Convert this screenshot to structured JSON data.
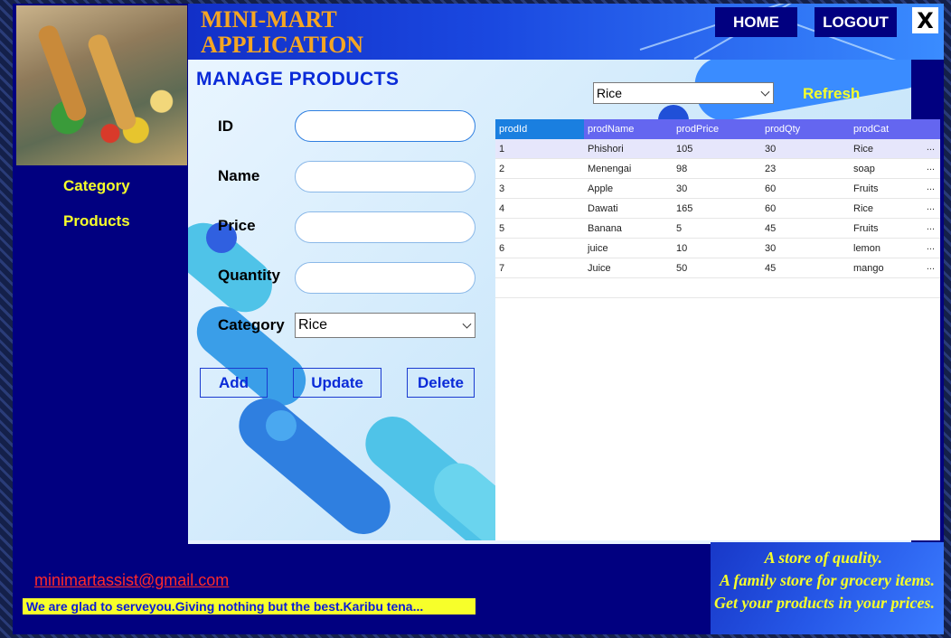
{
  "app": {
    "title_line1": "MINI-MART",
    "title_line2": "APPLICATION",
    "home_label": "HOME",
    "logout_label": "LOGOUT",
    "close_label": "X"
  },
  "sidebar": {
    "items": [
      {
        "label": "Category"
      },
      {
        "label": "Products"
      }
    ]
  },
  "page": {
    "title": "MANAGE PRODUCTS"
  },
  "form": {
    "id_label": "ID",
    "id_value": "",
    "name_label": "Name",
    "name_value": "",
    "price_label": "Price",
    "price_value": "",
    "quantity_label": "Quantity",
    "quantity_value": "",
    "category_label": "Category",
    "category_value": "Rice",
    "add_label": "Add",
    "update_label": "Update",
    "delete_label": "Delete"
  },
  "filter": {
    "category_value": "Rice",
    "refresh_label": "Refresh"
  },
  "grid": {
    "columns": [
      "prodId",
      "prodName",
      "prodPrice",
      "prodQty",
      "prodCat"
    ],
    "rows": [
      [
        "1",
        "Phishori",
        "105",
        "30",
        "Rice"
      ],
      [
        "2",
        "Menengai",
        "98",
        "23",
        "soap"
      ],
      [
        "3",
        "Apple",
        "30",
        "60",
        "Fruits"
      ],
      [
        "4",
        "Dawati",
        "165",
        "60",
        "Rice"
      ],
      [
        "5",
        "Banana",
        "5",
        "45",
        "Fruits"
      ],
      [
        "6",
        "juice",
        "10",
        "30",
        "lemon"
      ],
      [
        "7",
        "Juice",
        "50",
        "45",
        "mango"
      ]
    ],
    "overflow_marker": "..."
  },
  "footer": {
    "email": "minimartassist@gmail.com",
    "marquee": "We are glad to serveyou.Giving nothing but the best.Karibu tena...",
    "slogan_line1": "A store of quality.",
    "slogan_line2": "A family store for grocery items.",
    "slogan_line3": "Get your products in your prices."
  },
  "colors": {
    "window_bg": "#010080",
    "title_orange": "#f5a623",
    "accent_yellow": "#f7ff2a",
    "accent_blue": "#0a2bd8",
    "email_red": "#ff2a2a"
  }
}
